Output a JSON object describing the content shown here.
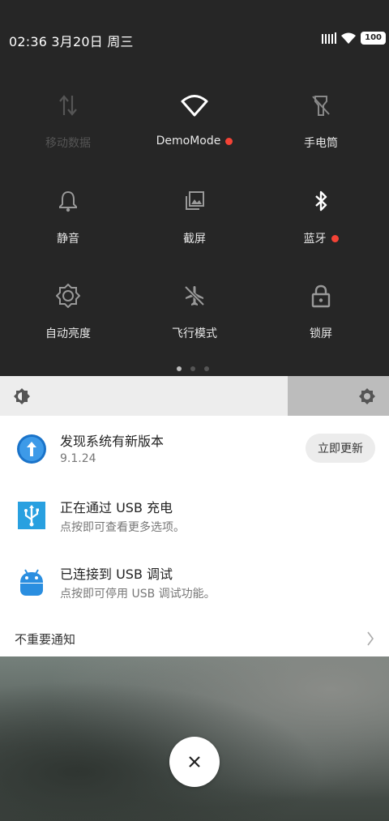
{
  "status_bar": {
    "time_date": "02:36 3月20日 周三",
    "battery": "100",
    "icons": [
      "signal-icon",
      "wifi-icon",
      "battery-icon"
    ]
  },
  "quick_settings": {
    "tiles": [
      {
        "label": "移动数据",
        "icon": "mobile-data-icon",
        "active": false
      },
      {
        "label": "DemoMode",
        "icon": "wifi-icon",
        "active": true,
        "badge": "red-dot"
      },
      {
        "label": "手电筒",
        "icon": "flashlight-off-icon",
        "active": false
      },
      {
        "label": "静音",
        "icon": "bell-icon",
        "active": false
      },
      {
        "label": "截屏",
        "icon": "screenshot-icon",
        "active": false
      },
      {
        "label": "蓝牙",
        "icon": "bluetooth-icon",
        "active": true,
        "badge": "red-dot"
      },
      {
        "label": "自动亮度",
        "icon": "auto-brightness-icon",
        "active": false
      },
      {
        "label": "飞行模式",
        "icon": "airplane-icon",
        "active": false
      },
      {
        "label": "锁屏",
        "icon": "lock-icon",
        "active": false
      }
    ],
    "pager": {
      "pages": 3,
      "current": 1
    }
  },
  "brightness": {
    "level": 0.74,
    "left_icon": "brightness-icon",
    "right_icon": "settings-gear-icon"
  },
  "notifications": [
    {
      "title": "发现系统有新版本",
      "subtitle": "9.1.24",
      "icon": "update-arrow-icon",
      "action": "立即更新"
    },
    {
      "title": "正在通过 USB 充电",
      "subtitle": "点按即可查看更多选项。",
      "icon": "usb-icon"
    },
    {
      "title": "已连接到 USB 调试",
      "subtitle": "点按即可停用 USB 调试功能。",
      "icon": "android-icon"
    }
  ],
  "unimportant": {
    "label": "不重要通知"
  },
  "colors": {
    "accent_red": "#f44336",
    "usb_blue": "#29a0e0",
    "panel_dark": "#262626"
  }
}
